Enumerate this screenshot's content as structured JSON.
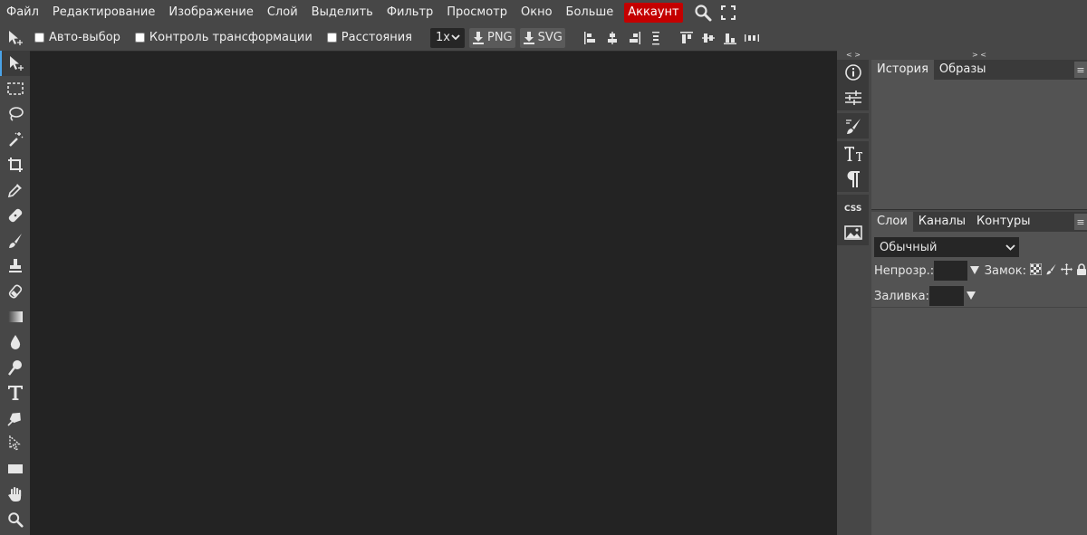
{
  "menu": {
    "items": [
      "Файл",
      "Редактирование",
      "Изображение",
      "Слой",
      "Выделить",
      "Фильтр",
      "Просмотр",
      "Окно",
      "Больше"
    ],
    "account": "Аккаунт",
    "icons": [
      "search-icon",
      "fullscreen-icon"
    ],
    "account_color": "#c40000"
  },
  "options": {
    "auto_select": "Авто-выбор",
    "transform_controls": "Контроль трансформации",
    "distances": "Расстояния",
    "scale": "1x",
    "png": "PNG",
    "svg": "SVG"
  },
  "tools": [
    "move-tool-icon",
    "marquee-tool-icon",
    "lasso-tool-icon",
    "magic-wand-icon",
    "crop-tool-icon",
    "eyedropper-icon",
    "healing-brush-icon",
    "brush-tool-icon",
    "clone-stamp-icon",
    "eraser-icon",
    "gradient-tool-icon",
    "blur-tool-icon",
    "dodge-tool-icon",
    "text-tool-icon",
    "pen-tool-icon",
    "path-select-icon",
    "shape-tool-icon",
    "hand-tool-icon",
    "zoom-tool-icon"
  ],
  "history_panel": {
    "tabs": [
      "История",
      "Образы"
    ],
    "collapse": "> <"
  },
  "strip": {
    "collapse": "< >"
  },
  "layers_panel": {
    "tabs": [
      "Слои",
      "Каналы",
      "Контуры"
    ],
    "blend_mode": "Обычный",
    "opacity_label": "Непрозр.:",
    "lock_label": "Замок:",
    "fill_label": "Заливка:"
  },
  "colors": {
    "accent": "#4aa3e8",
    "canvas": "#232323",
    "panel": "#535353",
    "chrome": "#474747"
  }
}
